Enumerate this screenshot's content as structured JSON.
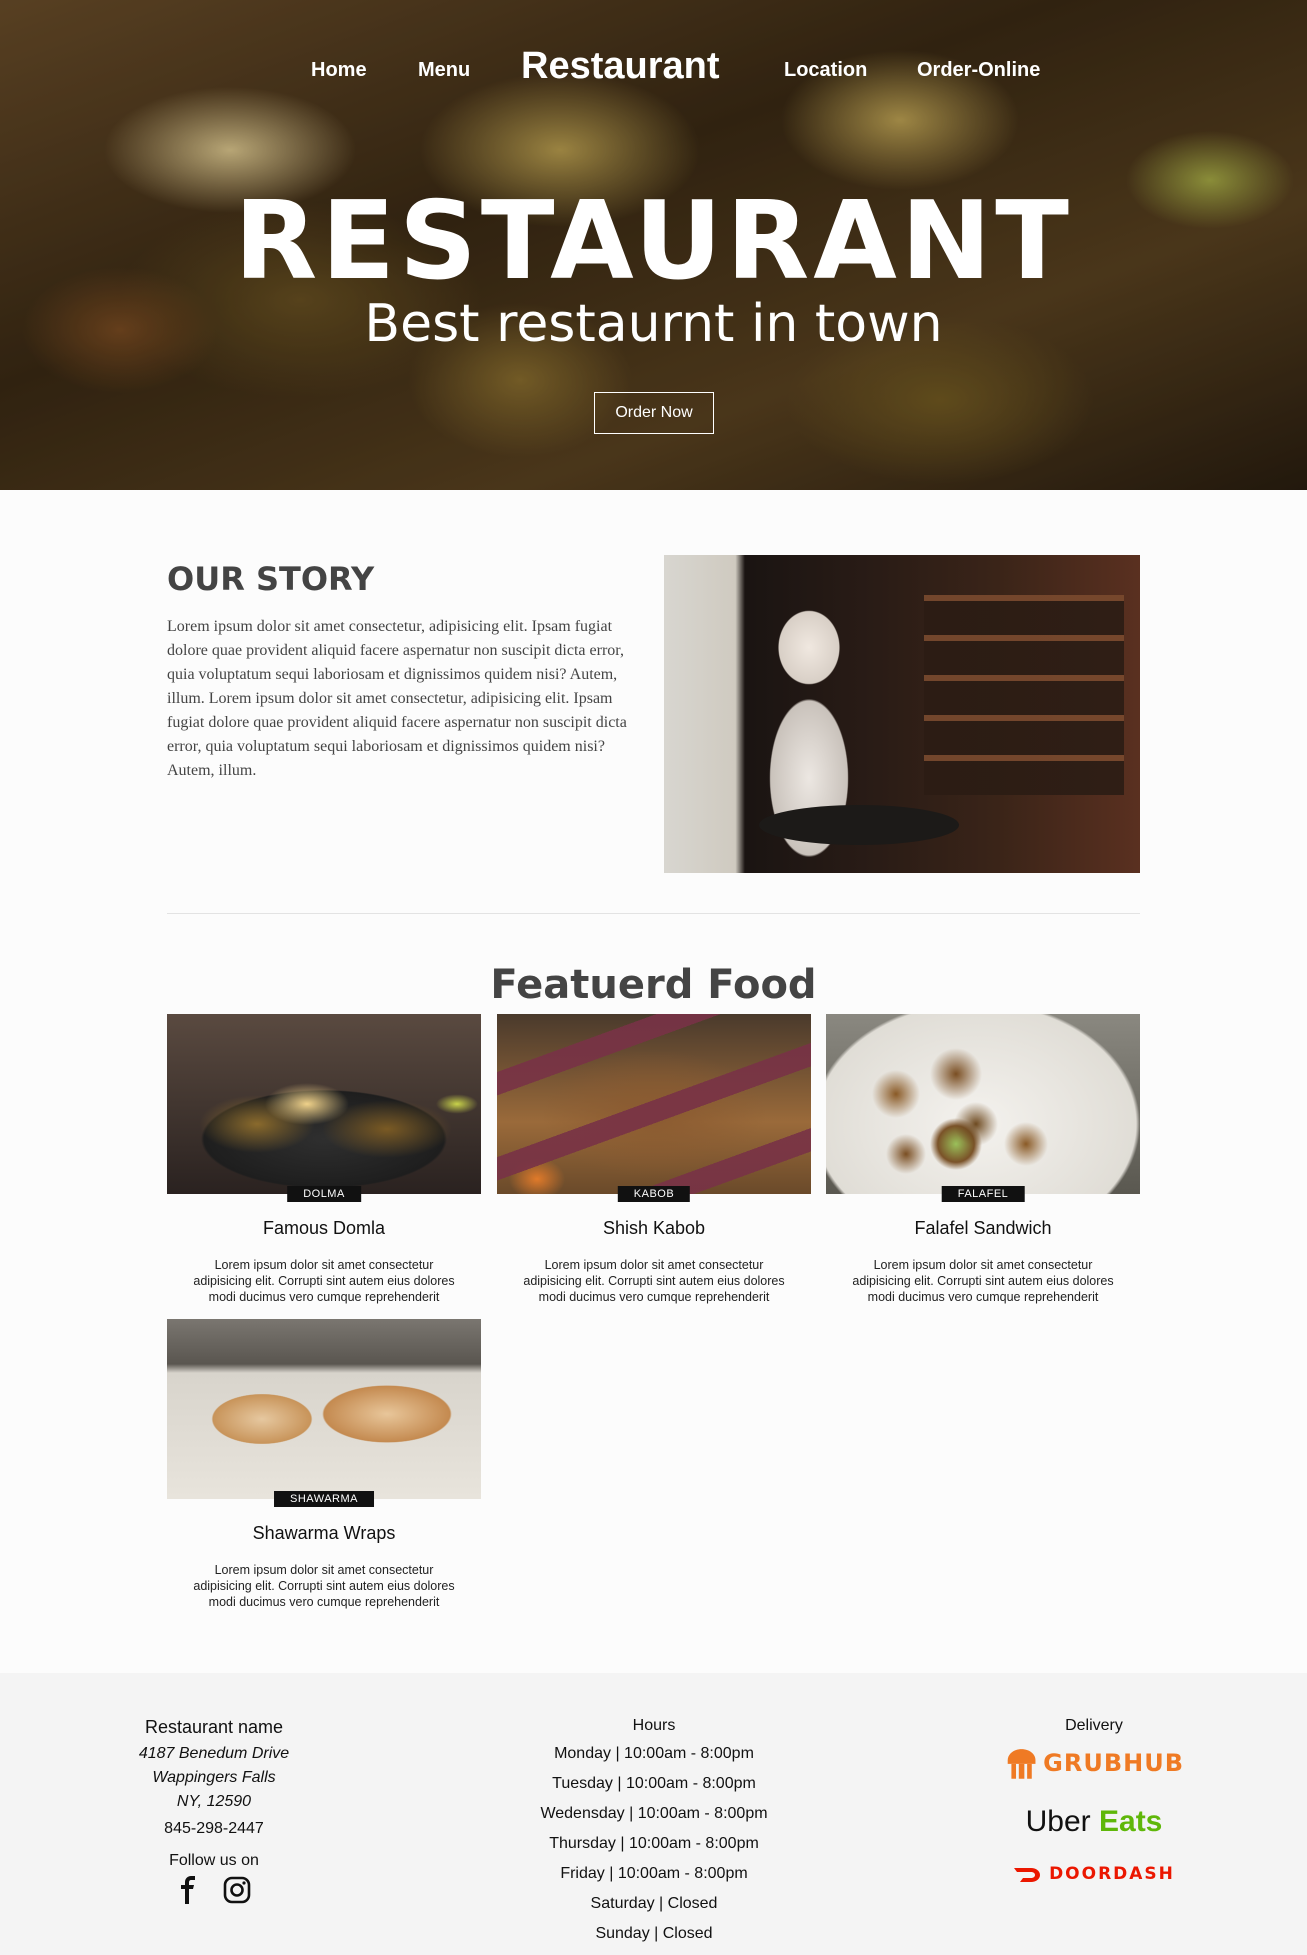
{
  "nav": {
    "items": [
      "Home",
      "Menu",
      "Location",
      "Order-Online"
    ],
    "brand": "Restaurant"
  },
  "hero": {
    "title": "RESTAURANT",
    "subtitle": "Best restaurnt in town",
    "button": "Order Now"
  },
  "story": {
    "title": "OUR STORY",
    "text": "Lorem ipsum dolor sit amet consectetur, adipisicing elit. Ipsam fugiat dolore quae provident aliquid facere aspernatur non suscipit dicta error, quia voluptatum sequi laboriosam et dignissimos quidem nisi? Autem, illum. Lorem ipsum dolor sit amet consectetur, adipisicing elit. Ipsam fugiat dolore quae provident aliquid facere aspernatur non suscipit dicta error, quia voluptatum sequi laboriosam et dignissimos quidem nisi? Autem, illum."
  },
  "featured": {
    "title": "Featuerd Food",
    "items": [
      {
        "tag": "DOLMA",
        "name": "Famous Domla",
        "desc": "Lorem ipsum dolor sit amet consectetur adipisicing elit. Corrupti sint autem eius dolores modi ducimus vero cumque reprehenderit"
      },
      {
        "tag": "KABOB",
        "name": "Shish Kabob",
        "desc": "Lorem ipsum dolor sit amet consectetur adipisicing elit. Corrupti sint autem eius dolores modi ducimus vero cumque reprehenderit"
      },
      {
        "tag": "FALAFEL",
        "name": "Falafel Sandwich",
        "desc": "Lorem ipsum dolor sit amet consectetur adipisicing elit. Corrupti sint autem eius dolores modi ducimus vero cumque reprehenderit"
      },
      {
        "tag": "SHAWARMA",
        "name": "Shawarma Wraps",
        "desc": "Lorem ipsum dolor sit amet consectetur adipisicing elit. Corrupti sint autem eius dolores modi ducimus vero cumque reprehenderit"
      }
    ]
  },
  "footer": {
    "restaurant_name": "Restaurant name",
    "address": [
      "4187 Benedum Drive",
      "Wappingers Falls",
      "NY, 12590"
    ],
    "phone": "845-298-2447",
    "follow": "Follow us on",
    "hours_title": "Hours",
    "hours": [
      "Monday | 10:00am - 8:00pm",
      "Tuesday | 10:00am - 8:00pm",
      "Wedensday | 10:00am - 8:00pm",
      "Thursday | 10:00am - 8:00pm",
      "Friday | 10:00am - 8:00pm",
      "Saturday | Closed",
      "Sunday | Closed"
    ],
    "delivery_title": "Delivery",
    "delivery": {
      "grubhub": "GRUBHUB",
      "uber": "Uber",
      "eats": "Eats",
      "doordash": "DOORDASH"
    }
  },
  "colors": {
    "grubhub": "#ef7a24",
    "ubereats": "#5fb709",
    "doordash": "#eb1700"
  }
}
